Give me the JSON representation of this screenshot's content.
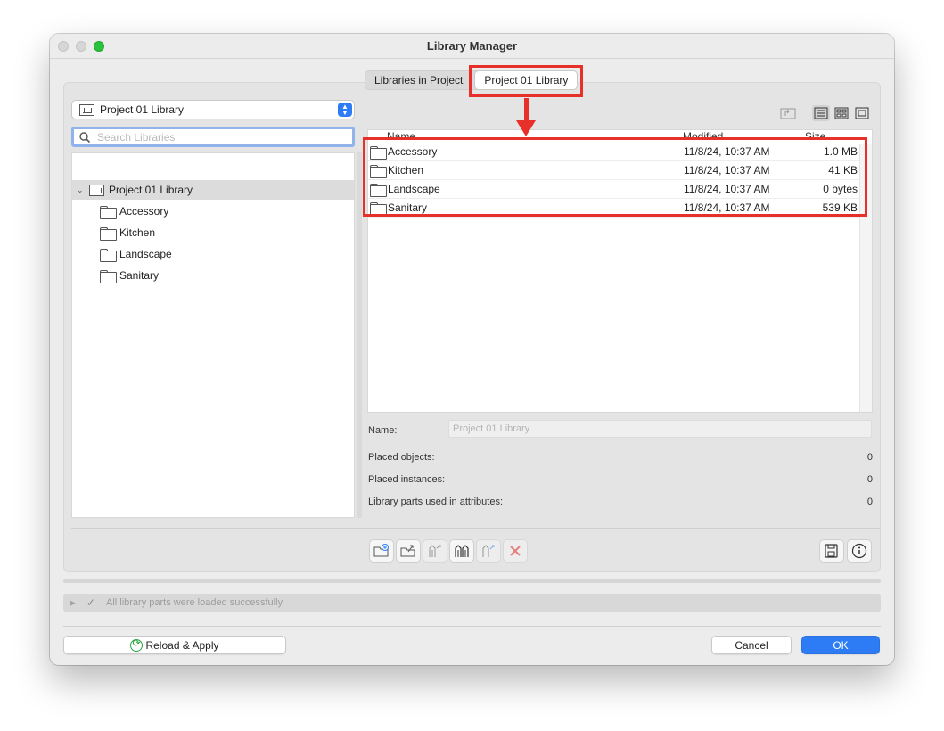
{
  "window": {
    "title": "Library Manager"
  },
  "tabs": [
    {
      "label": "Libraries in Project"
    },
    {
      "label": "Project 01 Library"
    }
  ],
  "library_select": {
    "value": "Project 01 Library"
  },
  "search": {
    "placeholder": "Search Libraries",
    "value": ""
  },
  "tree": {
    "root": "Project 01 Library",
    "children": [
      "Accessory",
      "Kitchen",
      "Landscape",
      "Sanitary"
    ]
  },
  "file_list": {
    "headers": {
      "name": "Name",
      "modified": "Modified",
      "size": "Size"
    },
    "rows": [
      {
        "name": "Accessory",
        "modified": "11/8/24, 10:37 AM",
        "size": "1.0 MB"
      },
      {
        "name": "Kitchen",
        "modified": "11/8/24, 10:37 AM",
        "size": "41 KB"
      },
      {
        "name": "Landscape",
        "modified": "11/8/24, 10:37 AM",
        "size": "0 bytes"
      },
      {
        "name": "Sanitary",
        "modified": "11/8/24, 10:37 AM",
        "size": "539 KB"
      }
    ]
  },
  "info": {
    "name_label": "Name:",
    "name_value": "Project 01 Library",
    "placed_objects_label": "Placed objects:",
    "placed_objects_value": "0",
    "placed_instances_label": "Placed instances:",
    "placed_instances_value": "0",
    "attr_parts_label": "Library parts used in attributes:",
    "attr_parts_value": "0"
  },
  "status": {
    "text": "All library parts were loaded successfully"
  },
  "buttons": {
    "reload": "Reload & Apply",
    "cancel": "Cancel",
    "ok": "OK"
  },
  "colors": {
    "highlight": "#e8302a",
    "accent": "#2d7cf6",
    "success": "#2aa642"
  }
}
